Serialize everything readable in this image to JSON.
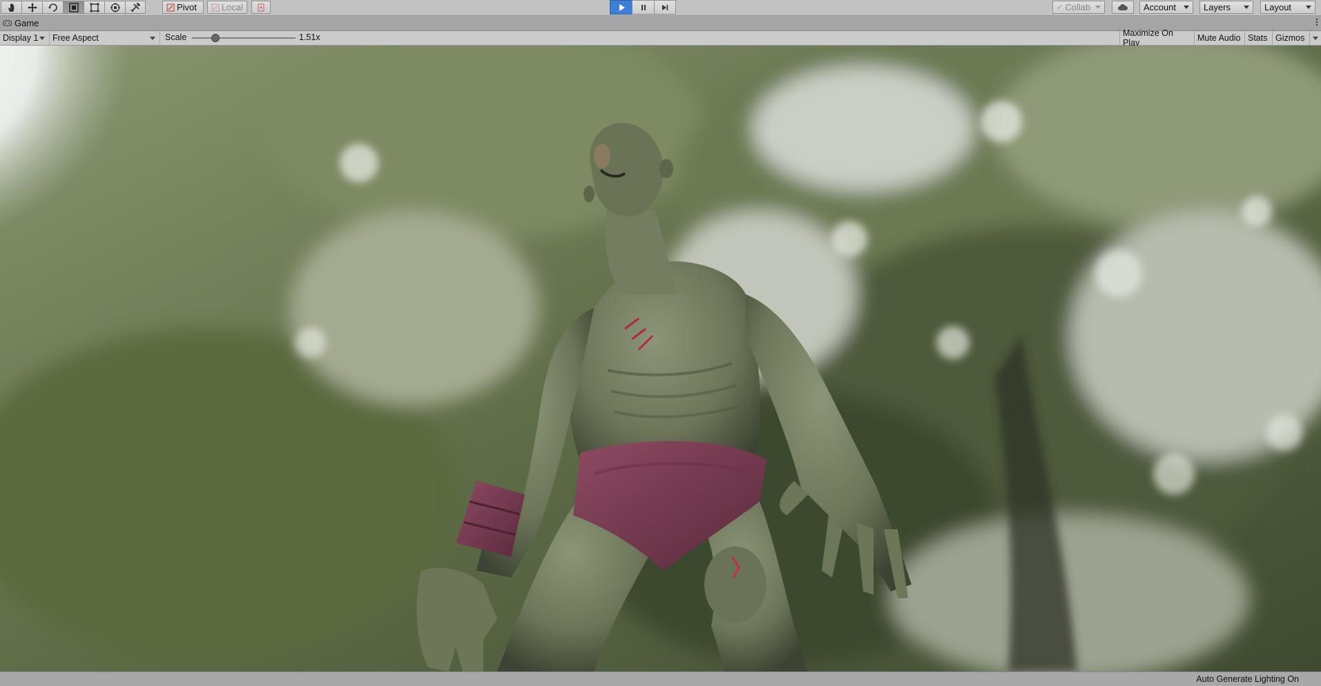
{
  "toolbar": {
    "tools": [
      "hand-tool-icon",
      "move-tool-icon",
      "rotate-tool-icon",
      "scale-tool-icon",
      "rect-tool-icon",
      "transform-tool-icon",
      "custom-tool-icon"
    ],
    "pivot_label": "Pivot",
    "local_label": "Local",
    "collab_label": "Collab",
    "account_label": "Account",
    "layers_label": "Layers",
    "layout_label": "Layout"
  },
  "playmode": {
    "play_active": true
  },
  "game_tab": {
    "title": "Game"
  },
  "game_bar": {
    "display": "Display 1",
    "aspect": "Free Aspect",
    "scale_label": "Scale",
    "scale_value": "1.51x",
    "scale_fraction": 0.22,
    "maximize_label": "Maximize On Play",
    "mute_label": "Mute Audio",
    "stats_label": "Stats",
    "gizmos_label": "Gizmos"
  },
  "status": {
    "text": "Auto Generate Lighting On"
  },
  "colors": {
    "accent": "#3c7fd6",
    "toolbar_bg": "#c2c2c2",
    "panel_bg": "#cbcbcb"
  }
}
